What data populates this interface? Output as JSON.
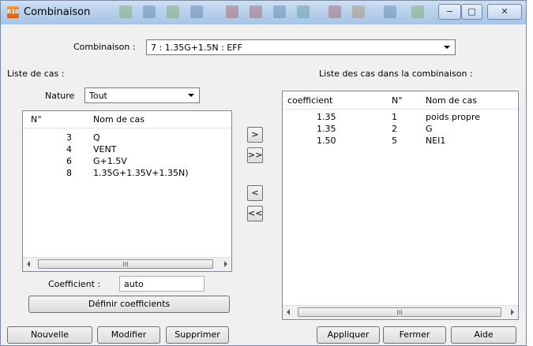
{
  "window": {
    "title": "Combinaison",
    "app_icon_text": "R10"
  },
  "combination": {
    "label": "Combinaison :",
    "selected": "7 : 1.35G+1.5N : EFF"
  },
  "left": {
    "title": "Liste de cas :",
    "nature_label": "Nature",
    "nature_selected": "Tout",
    "columns": [
      "N°",
      "Nom de cas"
    ],
    "rows": [
      {
        "n": "3",
        "name": "Q"
      },
      {
        "n": "4",
        "name": "VENT"
      },
      {
        "n": "6",
        "name": "G+1.5V"
      },
      {
        "n": "8",
        "name": "1.35G+1.35V+1.35N)"
      }
    ],
    "scroll_grip": "III",
    "coef_label": "Coefficient :",
    "coef_value": "auto",
    "define_button": "Définir coefficients"
  },
  "transfer": {
    "add": ">",
    "add_all": ">>",
    "remove": "<",
    "remove_all": "<<"
  },
  "right": {
    "title": "Liste des cas dans la combinaison :",
    "columns": [
      "coefficient",
      "N°",
      "Nom de cas"
    ],
    "rows": [
      {
        "coef": "1.35",
        "n": "1",
        "name": "poids propre"
      },
      {
        "coef": "1.35",
        "n": "2",
        "name": "G"
      },
      {
        "coef": "1.50",
        "n": "5",
        "name": "NEI1"
      }
    ],
    "scroll_grip": "III"
  },
  "buttons": {
    "new": "Nouvelle",
    "modify": "Modifier",
    "delete": "Supprimer",
    "apply": "Appliquer",
    "close": "Fermer",
    "help": "Aide"
  },
  "caption_buttons": {
    "minimize": "−",
    "maximize": "□",
    "close": "✕"
  },
  "colors": {
    "titlebar": "#b9d1ec",
    "window_bg": "#f0f0f0",
    "app_icon": "#e8721c"
  }
}
